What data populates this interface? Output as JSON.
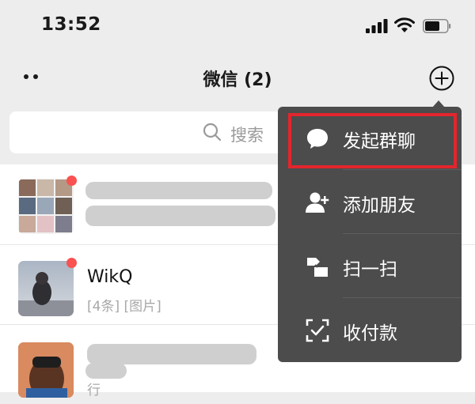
{
  "status_bar": {
    "time": "13:52"
  },
  "header": {
    "title": "微信 (2)"
  },
  "search": {
    "placeholder": "搜索"
  },
  "chats": [
    {
      "preview": "[...]"
    },
    {
      "name": "WikQ",
      "preview": "[4条] [图片]"
    },
    {
      "preview": "行"
    }
  ],
  "menu": {
    "items": [
      {
        "label": "发起群聊",
        "icon": "chat-bubble-icon"
      },
      {
        "label": "添加朋友",
        "icon": "add-friend-icon"
      },
      {
        "label": "扫一扫",
        "icon": "scan-icon"
      },
      {
        "label": "收付款",
        "icon": "payment-icon"
      }
    ]
  },
  "colors": {
    "background": "#ededed",
    "menu_background": "#4c4c4c",
    "highlight": "#e3252d",
    "unread_dot": "#fa5151"
  }
}
